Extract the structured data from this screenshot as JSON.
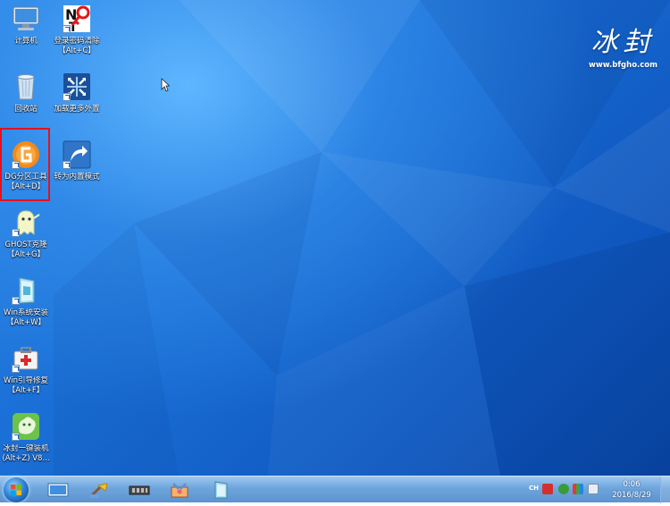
{
  "desktop": {
    "icons": [
      {
        "label_line1": "计算机",
        "label_line2": "",
        "icon": "computer-icon"
      },
      {
        "label_line1": "登录密码清除",
        "label_line2": "【Alt+C】",
        "icon": "password-clear-icon"
      },
      {
        "label_line1": "回收站",
        "label_line2": "",
        "icon": "recycle-bin-icon"
      },
      {
        "label_line1": "加载更多外置",
        "label_line2": "",
        "icon": "load-more-icon"
      },
      {
        "label_line1": "DG分区工具",
        "label_line2": "【Alt+D】",
        "icon": "diskgenius-icon"
      },
      {
        "label_line1": "转为内置模式",
        "label_line2": "",
        "icon": "switch-mode-icon"
      },
      {
        "label_line1": "GHOST克隆",
        "label_line2": "【Alt+G】",
        "icon": "ghost-icon"
      },
      {
        "label_line1": "Win系统安装",
        "label_line2": "【Alt+W】",
        "icon": "windows-install-icon"
      },
      {
        "label_line1": "Win引导修复",
        "label_line2": "【Alt+F】",
        "icon": "boot-repair-icon"
      },
      {
        "label_line1": "冰封一键装机",
        "label_line2": "(Alt+Z) V8...",
        "icon": "bingfeng-install-icon"
      }
    ]
  },
  "logo": {
    "title": "冰封",
    "url": "www.bfgho.com"
  },
  "taskbar": {
    "tray_lang": "CH",
    "clock_time": "0:06",
    "clock_date": "2016/8/29"
  },
  "colors": {
    "highlight": "#e8101a",
    "desktop_blue": "#1a6fd6",
    "taskbar": "#6ea5dc"
  }
}
